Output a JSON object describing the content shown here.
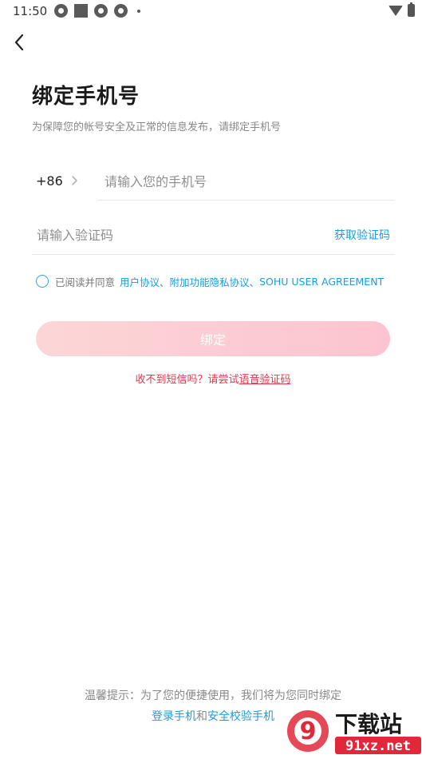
{
  "status_bar": {
    "time": "11:50",
    "icons": [
      "pinwheel-icon",
      "square-icon",
      "pinwheel-icon",
      "pinwheel-icon",
      "dot-icon",
      "wifi-icon",
      "battery-icon"
    ]
  },
  "header": {
    "title": "绑定手机号",
    "subtitle": "为保障您的帐号安全及正常的信息发布，请绑定手机号"
  },
  "form": {
    "country_code": "+86",
    "phone_placeholder": "请输入您的手机号",
    "code_placeholder": "请输入验证码",
    "get_code_label": "获取验证码"
  },
  "agreement": {
    "prefix": "已阅读并同意",
    "links": [
      "用户协议",
      "附加功能隐私协议",
      "SOHU USER AGREEMENT"
    ],
    "separator": "、"
  },
  "bind_button_label": "绑定",
  "sms_help": {
    "text": "收不到短信吗？请尝试",
    "link": "语音验证码"
  },
  "footer": {
    "tip": "温馨提示：为了您的便捷使用，我们将为您同时绑定",
    "link1": "登录手机",
    "connector": "和",
    "link2": "安全校验手机"
  },
  "watermark": {
    "text_cn": "下载站",
    "text_url": "91xz.net",
    "logo_text": "9"
  },
  "colors": {
    "accent_blue": "#1e9be0",
    "warning_red": "#e2394d",
    "button_pink": "#fcc8d2",
    "watermark_red": "#e0283a"
  }
}
